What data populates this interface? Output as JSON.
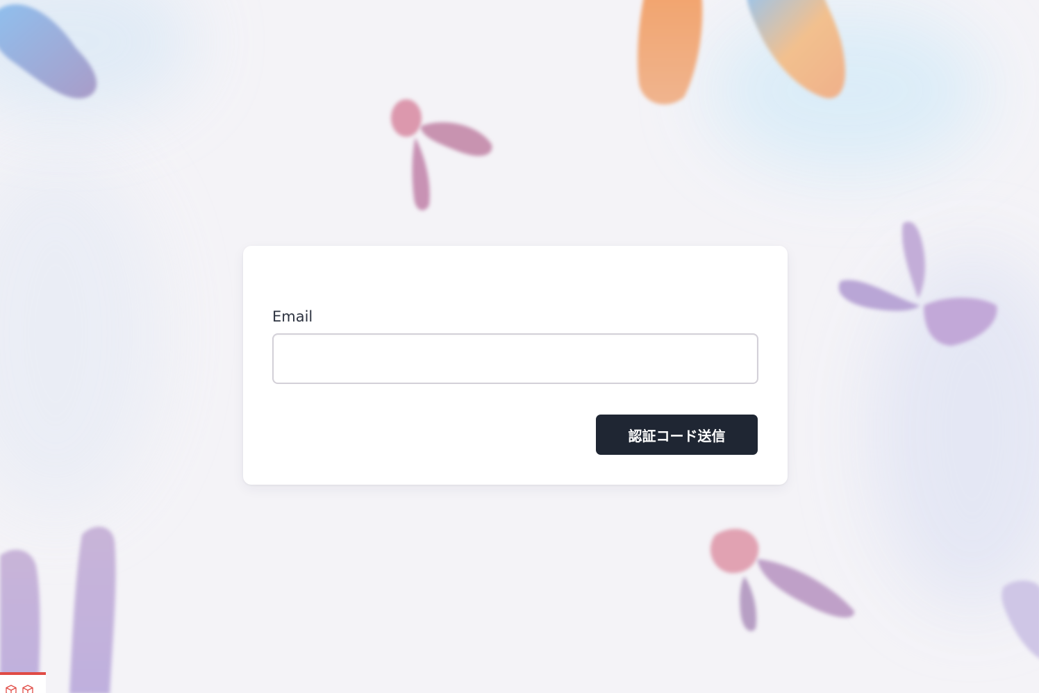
{
  "form": {
    "email_label": "Email",
    "email_value": "",
    "email_placeholder": "",
    "submit_label": "認証コード送信"
  },
  "colors": {
    "button_bg": "#1f2633",
    "button_text": "#ffffff",
    "card_bg": "#ffffff",
    "page_bg": "#f4f3f7",
    "corner_accent": "#e04b45"
  },
  "icons": {
    "corner_icons": [
      "cube-icon",
      "cube-icon"
    ]
  }
}
